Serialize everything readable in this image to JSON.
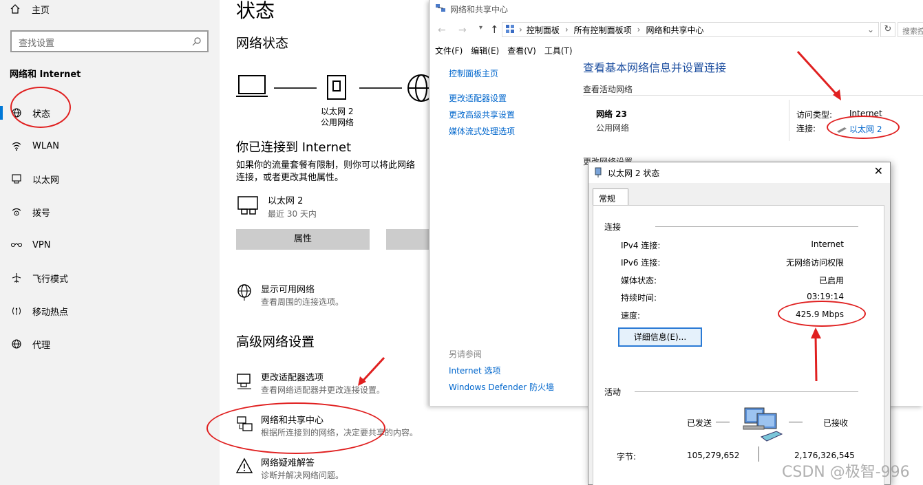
{
  "settings": {
    "home": "主页",
    "search_placeholder": "查找设置",
    "section_title": "网络和 Internet",
    "nav": [
      {
        "label": "状态",
        "icon": "globe-status-icon"
      },
      {
        "label": "WLAN",
        "icon": "wifi-icon"
      },
      {
        "label": "以太网",
        "icon": "ethernet-icon"
      },
      {
        "label": "拨号",
        "icon": "dialup-icon"
      },
      {
        "label": "VPN",
        "icon": "vpn-icon"
      },
      {
        "label": "飞行模式",
        "icon": "airplane-icon"
      },
      {
        "label": "移动热点",
        "icon": "hotspot-icon"
      },
      {
        "label": "代理",
        "icon": "proxy-globe-icon"
      }
    ],
    "page_title": "状态",
    "network_status": "网络状态",
    "diagram_label_1": "以太网 2",
    "diagram_label_2": "公用网络",
    "connected_title": "你已连接到 Internet",
    "connected_desc_1": "如果你的流量套餐有限制，则你可以将此网络",
    "connected_desc_2": "连接，或者更改其他属性。",
    "adapter_name": "以太网 2",
    "adapter_sub": "最近 30 天内",
    "properties_button": "属性",
    "show_networks_title": "显示可用网络",
    "show_networks_sub": "查看周围的连接选项。",
    "advanced_title": "高级网络设置",
    "adapter_options_title": "更改适配器选项",
    "adapter_options_sub": "查看网络适配器并更改连接设置。",
    "sharing_center_title": "网络和共享中心",
    "sharing_center_sub": "根据所连接到的网络，决定要共享的内容。",
    "troubleshoot_title": "网络疑难解答",
    "troubleshoot_sub": "诊断并解决网络问题。"
  },
  "control_panel": {
    "window_title": "网络和共享中心",
    "breadcrumb": [
      "控制面板",
      "所有控制面板项",
      "网络和共享中心"
    ],
    "search_placeholder": "搜索控",
    "menu": [
      "文件(F)",
      "编辑(E)",
      "查看(V)",
      "工具(T)"
    ],
    "left_links": [
      "控制面板主页",
      "更改适配器设置",
      "更改高级共享设置",
      "媒体流式处理选项"
    ],
    "see_also_label": "另请参阅",
    "see_also_links": [
      "Internet 选项",
      "Windows Defender 防火墙"
    ],
    "heading": "查看基本网络信息并设置连接",
    "active_networks_label": "查看活动网络",
    "network_name": "网络 23",
    "network_type": "公用网络",
    "access_type_label": "访问类型:",
    "access_type_value": "Internet",
    "connection_label": "连接:",
    "connection_value": "以太网 2",
    "change_settings_partial": "更改网络设置"
  },
  "status_dialog": {
    "title": "以太网 2 状态",
    "tab": "常规",
    "connection_group": "连接",
    "rows": [
      {
        "label": "IPv4 连接:",
        "value": "Internet"
      },
      {
        "label": "IPv6 连接:",
        "value": "无网络访问权限"
      },
      {
        "label": "媒体状态:",
        "value": "已启用"
      },
      {
        "label": "持续时间:",
        "value": "03:19:14"
      },
      {
        "label": "速度:",
        "value": "425.9 Mbps"
      }
    ],
    "details_button": "详细信息(E)...",
    "activity_group": "活动",
    "sent_label": "已发送",
    "received_label": "已接收",
    "bytes_label": "字节:",
    "bytes_sent": "105,279,652",
    "bytes_received": "2,176,326,545"
  },
  "watermark": "CSDN @极智-996",
  "colors": {
    "accent": "#0078d7",
    "link": "#0066cc",
    "annotation": "#e02020"
  }
}
